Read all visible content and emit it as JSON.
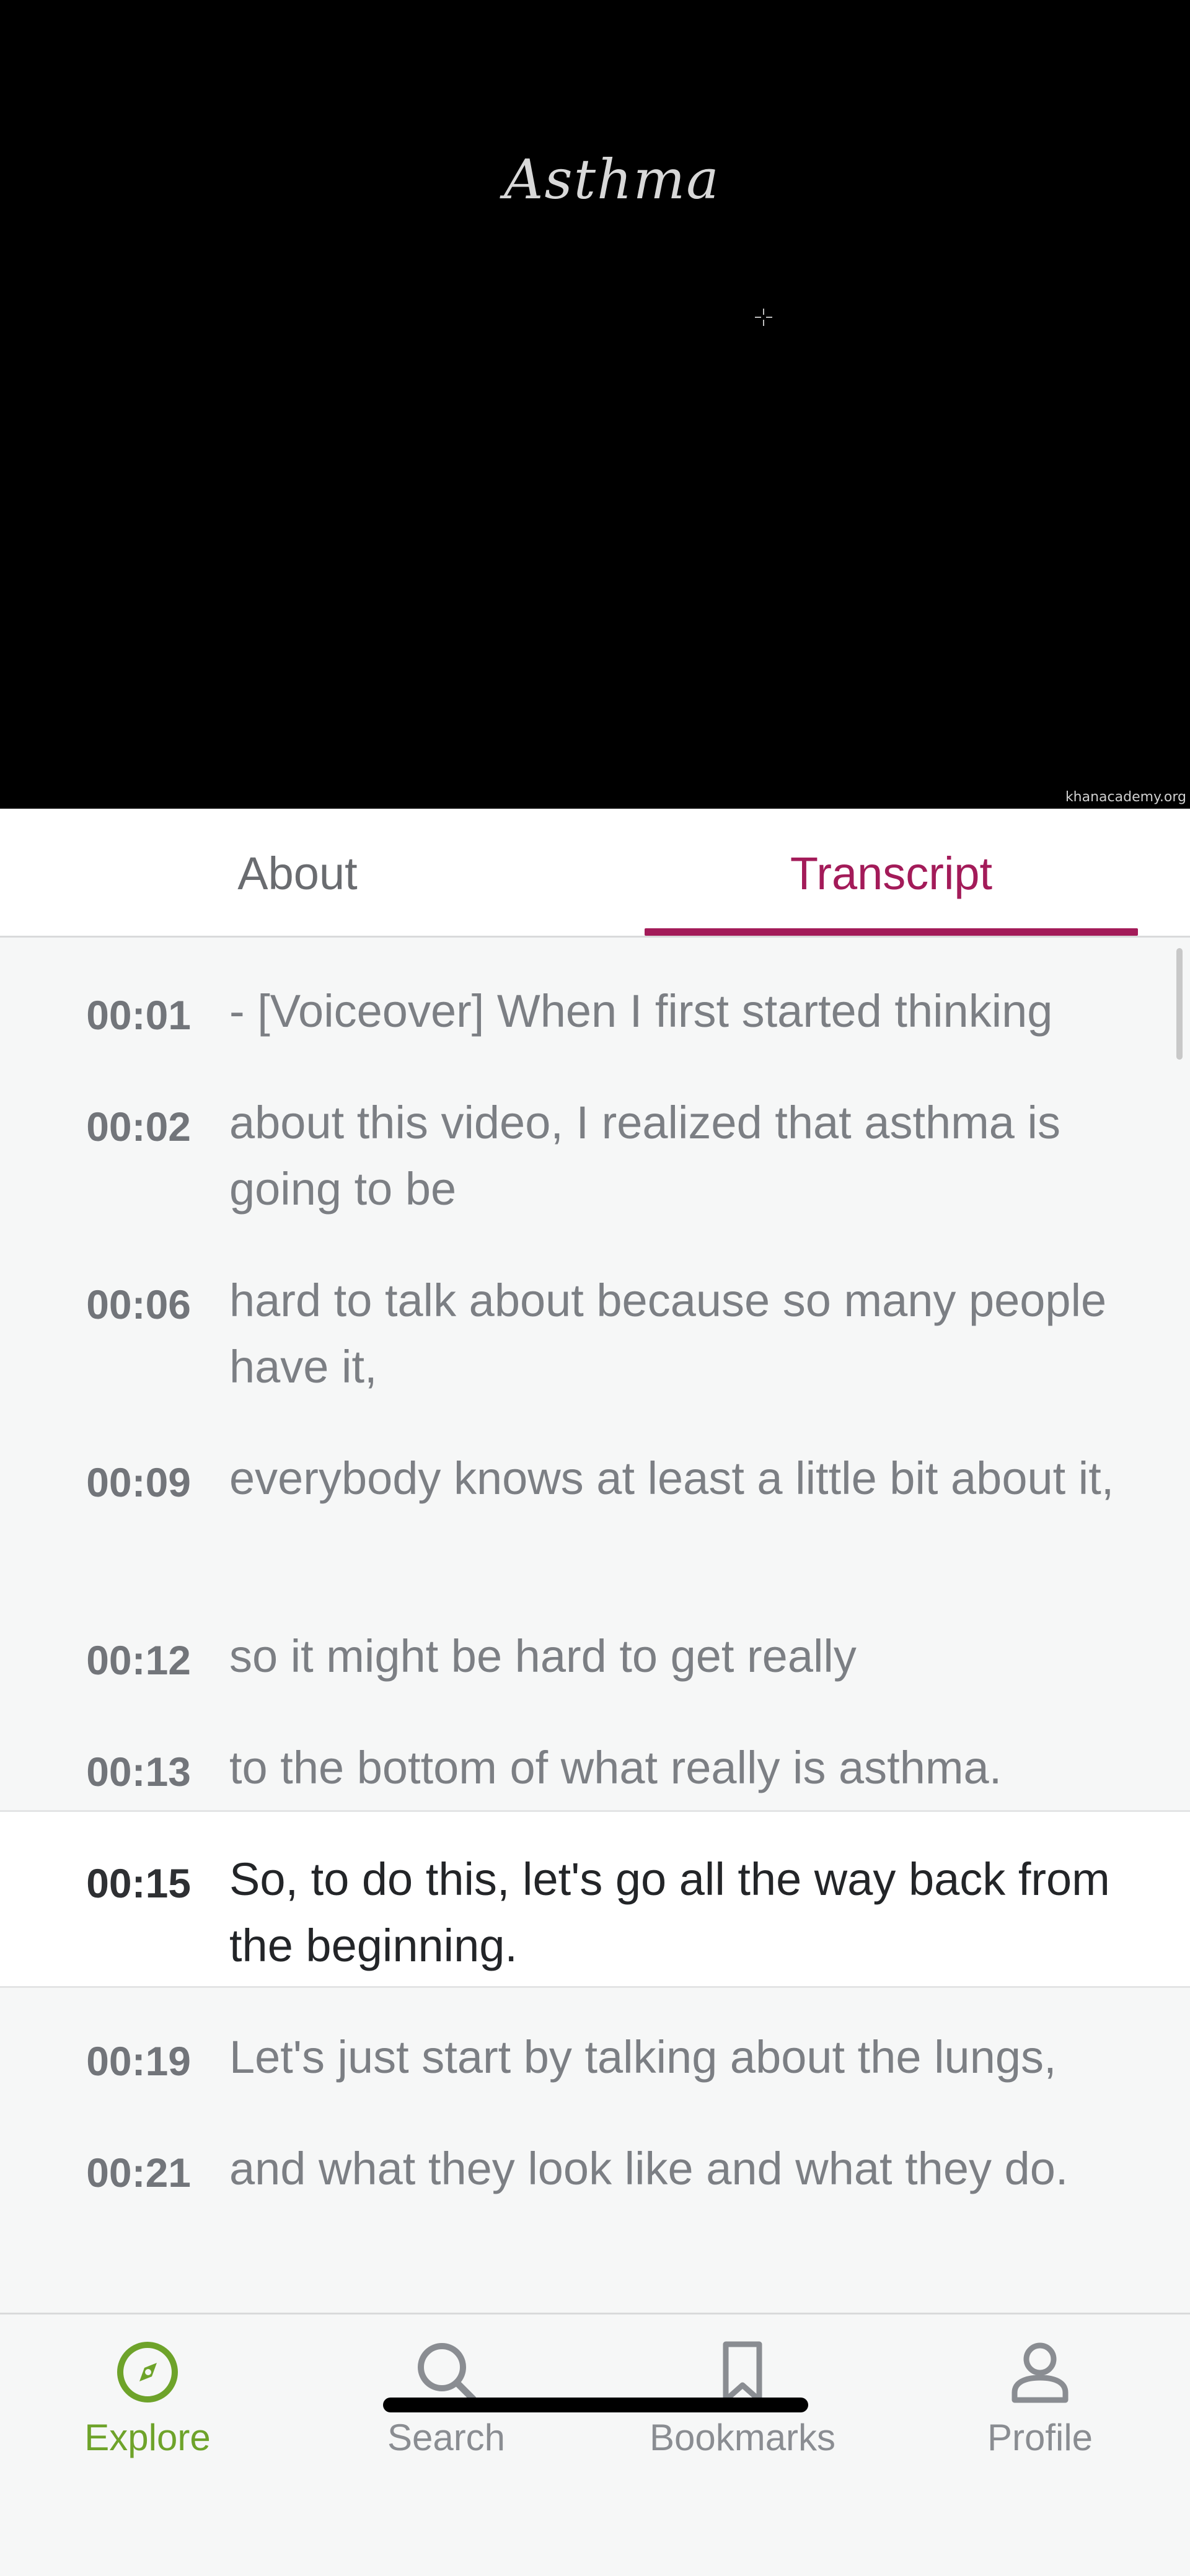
{
  "video": {
    "title": "Asthma",
    "watermark": "khanacademy.org"
  },
  "tabs": [
    {
      "label": "About",
      "selected": false
    },
    {
      "label": "Transcript",
      "selected": true
    }
  ],
  "colors": {
    "accent": "#a31b59",
    "explore_green": "#6ea32a",
    "video_bg": "#000000"
  },
  "transcript": [
    {
      "time": "00:01",
      "text": "- [Voiceover] When I first started thinking"
    },
    {
      "time": "00:02",
      "text": "about this video, I realized that asthma is going to be"
    },
    {
      "time": "00:06",
      "text": "hard to talk about because so many people have it,"
    },
    {
      "time": "00:09",
      "text": "everybody knows at least a little bit about it,"
    },
    {
      "time": "00:12",
      "text": "so it might be hard to get really"
    },
    {
      "time": "00:13",
      "text": "to the bottom of what really is asthma."
    },
    {
      "time": "00:15",
      "text": "So, to do this, let's go all the way back from the beginning.",
      "active": true
    },
    {
      "time": "00:19",
      "text": "Let's just start by talking about the lungs,"
    },
    {
      "time": "00:21",
      "text": "and what they look like and what they do."
    }
  ],
  "bottom_nav": [
    {
      "label": "Explore",
      "icon": "compass-icon",
      "selected": true
    },
    {
      "label": "Search",
      "icon": "search-icon"
    },
    {
      "label": "Bookmarks",
      "icon": "bookmark-icon"
    },
    {
      "label": "Profile",
      "icon": "person-icon"
    }
  ]
}
